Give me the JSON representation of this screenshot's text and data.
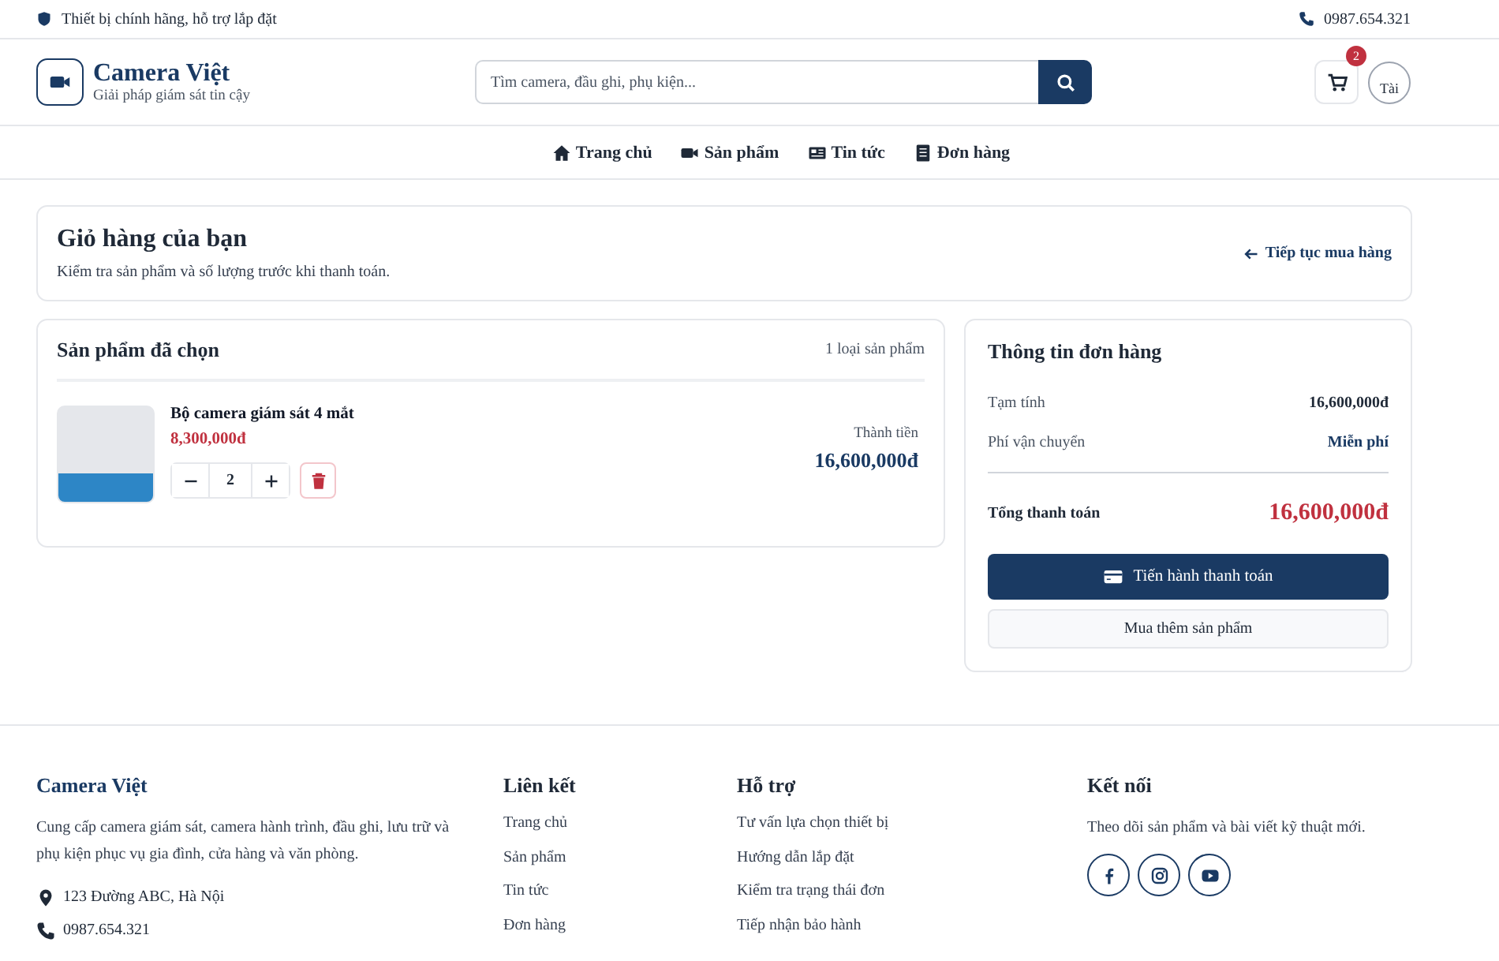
{
  "topbar": {
    "notice": "Thiết bị chính hãng, hỗ trợ lắp đặt",
    "phone": "0987.654.321"
  },
  "header": {
    "brand": "Camera Việt",
    "tagline": "Giải pháp giám sát tin cậy",
    "search": {
      "placeholder": "Tìm camera, đầu ghi, phụ kiện..."
    },
    "cart_count": "2",
    "avatar_alt": "Tài"
  },
  "nav": [
    {
      "label": "Trang chủ",
      "kind": "home"
    },
    {
      "label": "Sản phẩm",
      "kind": "camera"
    },
    {
      "label": "Tin tức",
      "kind": "news"
    },
    {
      "label": "Đơn hàng",
      "kind": "orders"
    }
  ],
  "page_head": {
    "title": "Giỏ hàng của bạn",
    "subtitle": "Kiểm tra sản phẩm và số lượng trước khi thanh toán.",
    "back_link": "Tiếp tục mua hàng"
  },
  "cart": {
    "title": "Sản phẩm đã chọn",
    "count": "1 loại sản phẩm",
    "items": [
      {
        "name": "Bộ camera giám sát 4 mắt",
        "price": "8,300,000đ",
        "quantity": "2",
        "total_label": "Thành tiền",
        "total": "16,600,000đ"
      }
    ]
  },
  "summary": {
    "title": "Thông tin đơn hàng",
    "rows": [
      {
        "label": "Tạm tính",
        "value": "16,600,000đ",
        "kind": "plain"
      },
      {
        "label": "Phí vận chuyển",
        "value": "Miễn phí",
        "kind": "accent"
      }
    ],
    "total_label": "Tổng thanh toán",
    "total": "16,600,000đ",
    "checkout": "Tiến hành thanh toán",
    "continue": "Mua thêm sản phẩm"
  },
  "footer": {
    "brand": "Camera Việt",
    "about": "Cung cấp camera giám sát, camera hành trình, đầu ghi, lưu trữ và phụ kiện phục vụ gia đình, cửa hàng và văn phòng.",
    "address": "123 Đường ABC, Hà Nội",
    "phone": "0987.654.321",
    "columns": [
      {
        "title": "Liên kết",
        "links": [
          "Trang chủ",
          "Sản phẩm",
          "Tin tức",
          "Đơn hàng"
        ]
      },
      {
        "title": "Hỗ trợ",
        "links": [
          "Tư vấn lựa chọn thiết bị",
          "Hướng dẫn lắp đặt",
          "Kiểm tra trạng thái đơn",
          "Tiếp nhận bảo hành"
        ]
      }
    ],
    "connect": {
      "title": "Kết nối",
      "text": "Theo dõi sản phẩm và bài viết kỹ thuật mới.",
      "socials": [
        {
          "kind": "facebook"
        },
        {
          "kind": "instagram"
        },
        {
          "kind": "youtube"
        }
      ]
    }
  }
}
